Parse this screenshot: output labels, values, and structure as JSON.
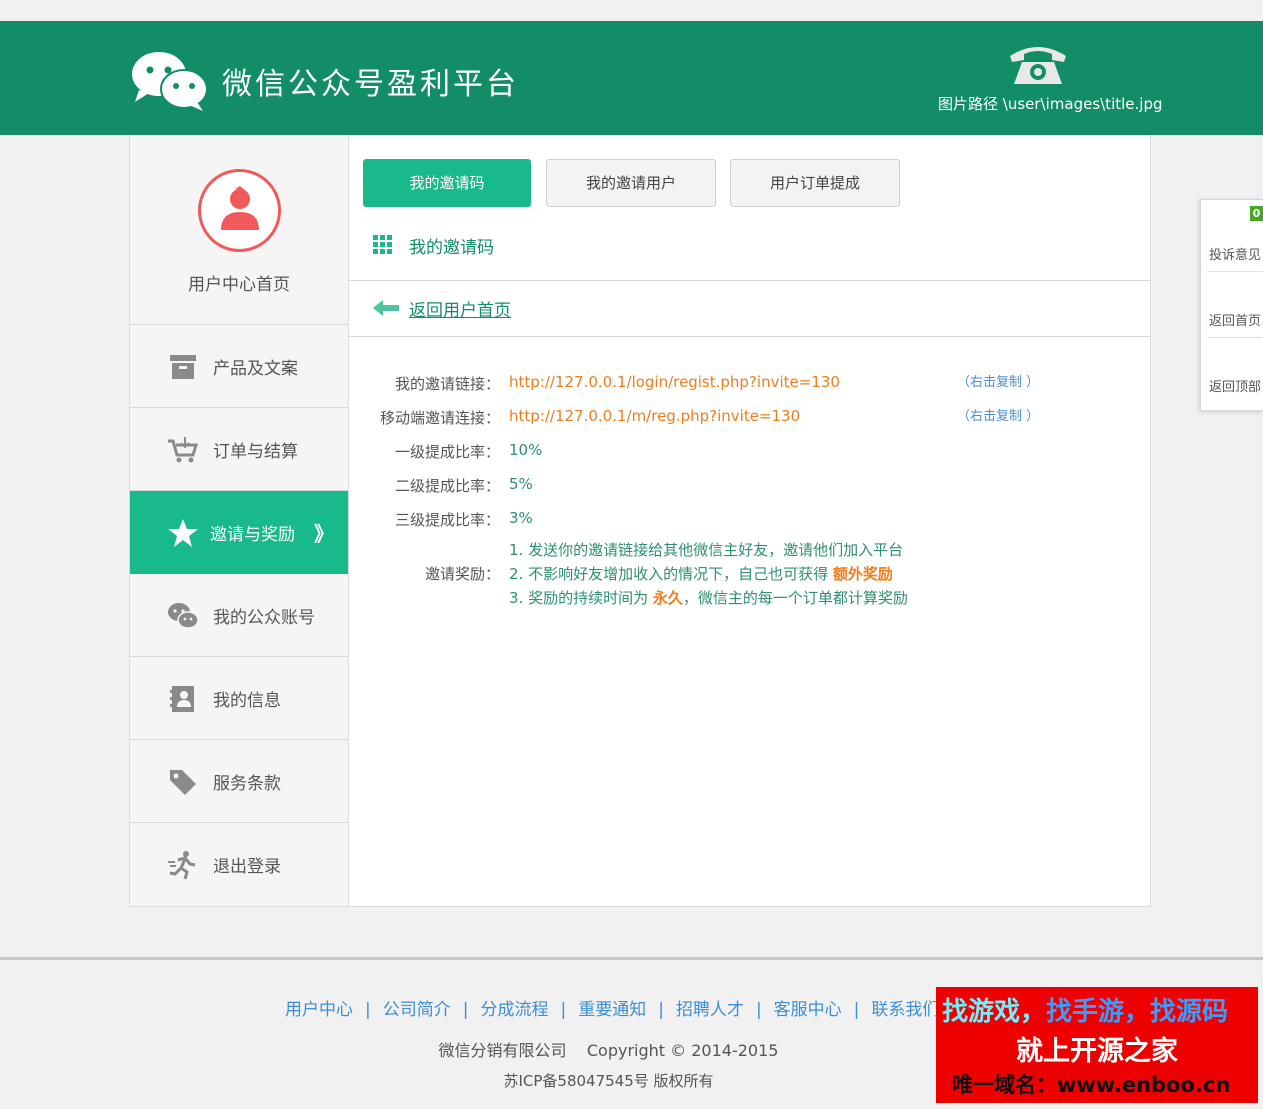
{
  "header": {
    "title": "微信公众号盈利平台",
    "image_path_note": "图片路径 \\user\\images\\title.jpg"
  },
  "sidebar": {
    "home_label": "用户中心首页",
    "items": [
      {
        "label": "产品及文案",
        "icon": "archive-box-icon"
      },
      {
        "label": "订单与结算",
        "icon": "shopping-cart-icon"
      },
      {
        "label": "邀请与奖励",
        "icon": "star-icon",
        "active": true
      },
      {
        "label": "我的公众账号",
        "icon": "wechat-bubble-icon"
      },
      {
        "label": "我的信息",
        "icon": "contact-book-icon"
      },
      {
        "label": "服务条款",
        "icon": "tag-icon"
      },
      {
        "label": "退出登录",
        "icon": "running-person-icon"
      }
    ],
    "active_chevron": "》"
  },
  "tabs": [
    {
      "label": "我的邀请码",
      "active": true
    },
    {
      "label": "我的邀请用户"
    },
    {
      "label": "用户订单提成"
    }
  ],
  "section_title": "我的邀请码",
  "back_link": "返回用户首页",
  "invite": {
    "link_label": "我的邀请链接：",
    "link_value": "http://127.0.0.1/login/regist.php?invite=130",
    "link_copy": "（右击复制 ）",
    "mobile_label": "移动端邀请连接：",
    "mobile_value": "http://127.0.0.1/m/reg.php?invite=130",
    "mobile_copy": "（右击复制 ）",
    "rate1_label": "一级提成比率：",
    "rate1_value": "10%",
    "rate2_label": "二级提成比率：",
    "rate2_value": "5%",
    "rate3_label": "三级提成比率：",
    "rate3_value": "3%",
    "reward_label": "邀请奖励：",
    "reward_1": "1. 发送你的邀请链接给其他微信主好友，邀请他们加入平台",
    "reward_2_pre": "2. 不影响好友增加收入的情况下，自己也可获得 ",
    "reward_2_hl": "额外奖励",
    "reward_3_pre": "3. 奖励的持续时间为 ",
    "reward_3_hl": "永久",
    "reward_3_post": "，微信主的每一个订单都计算奖励"
  },
  "float_panel": {
    "badge": "0",
    "items": [
      "投诉意见",
      "返回首页",
      "返回顶部"
    ]
  },
  "footer": {
    "nav": [
      "用户中心",
      "公司简介",
      "分成流程",
      "重要通知",
      "招聘人才",
      "客服中心",
      "联系我们"
    ],
    "separator": "|",
    "copyright": "微信分销有限公司    Copyright © 2014-2015",
    "icp": "苏ICP备58047545号 版权所有"
  },
  "ad": {
    "line1_a": "找游戏，",
    "line1_b": "找手游，",
    "line1_c": "找源码",
    "line2": "就上开源之家",
    "line3": "唯一域名：www.enboo.cn"
  },
  "colors": {
    "header_green": "#128d68",
    "accent_green": "#18b98b",
    "link_orange": "#f07d1e",
    "avatar_red": "#f15a5a"
  }
}
